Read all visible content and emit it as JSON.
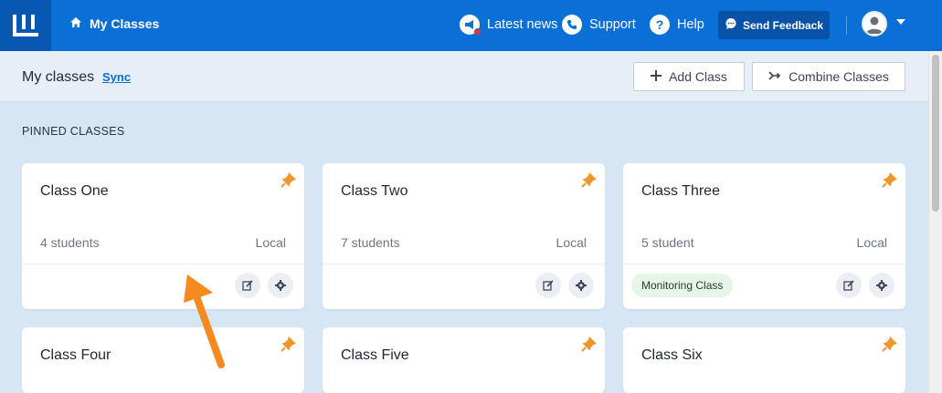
{
  "header": {
    "home_label": "My Classes",
    "latest_news_label": "Latest news",
    "support_label": "Support",
    "help_label": "Help",
    "feedback_label": "Send Feedback"
  },
  "subheader": {
    "title": "My classes",
    "sync_label": "Sync",
    "add_class_label": "Add Class",
    "combine_label": "Combine Classes"
  },
  "section": {
    "pinned_title": "PINNED CLASSES"
  },
  "cards": [
    {
      "name": "Class One",
      "students": "4 students",
      "location": "Local",
      "badge": ""
    },
    {
      "name": "Class Two",
      "students": "7 students",
      "location": "Local",
      "badge": ""
    },
    {
      "name": "Class Three",
      "students": "5 student",
      "location": "Local",
      "badge": "Monitoring Class"
    },
    {
      "name": "Class Four"
    },
    {
      "name": "Class Five"
    },
    {
      "name": "Class Six"
    }
  ],
  "colors": {
    "brand_blue": "#0a6fd6",
    "pin_orange": "#f0962a",
    "annotation_arrow": "#f58a1f"
  },
  "icons": [
    "logo-icon",
    "home-icon",
    "megaphone-icon",
    "phone-icon",
    "help-icon",
    "chat-icon",
    "avatar-icon",
    "plus-icon",
    "combine-icon",
    "pin-icon",
    "edit-icon",
    "gear-icon",
    "arrow-annotation"
  ]
}
